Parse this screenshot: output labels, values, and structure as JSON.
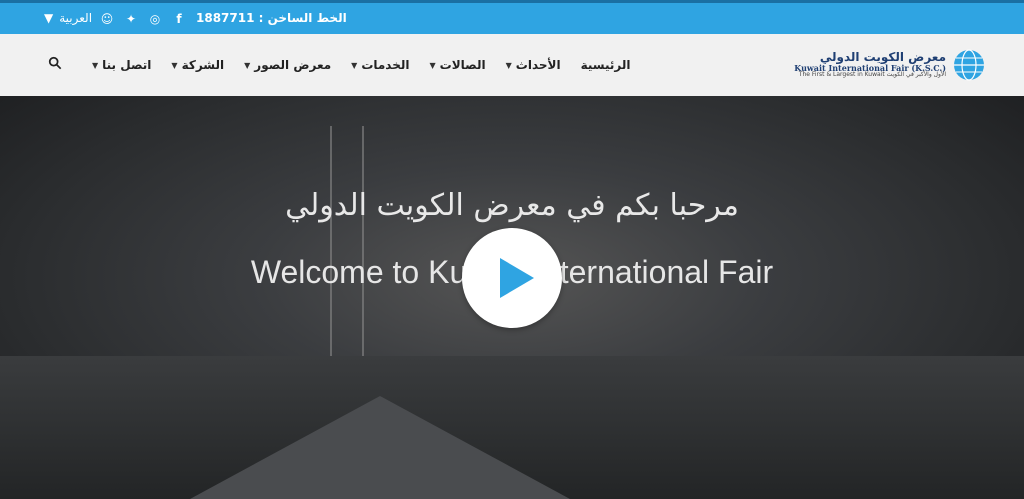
{
  "topbar": {
    "language": "العربية",
    "hotline": "الخط الساخن : 1887711",
    "social": [
      "snapchat-icon",
      "twitter-icon",
      "instagram-icon",
      "facebook-icon"
    ]
  },
  "navbar": {
    "menu": [
      {
        "label": "اتصل بنا"
      },
      {
        "label": "الشركة"
      },
      {
        "label": "معرض الصور"
      },
      {
        "label": "الخدمات"
      },
      {
        "label": "الصالات"
      },
      {
        "label": "الأحداث"
      },
      {
        "label": "الرئيسية"
      }
    ],
    "logo": {
      "arabic": "معرض الكويت الدولي",
      "english": "Kuwait International Fair (K.S.C.)",
      "tagline": "The First & Largest in Kuwait الأول والأكبر في الكويت"
    }
  },
  "hero": {
    "title_ar": "مرحبا بكم في معرض الكويت الدولي",
    "title_en": "Welcome to Kuwait International Fair"
  }
}
